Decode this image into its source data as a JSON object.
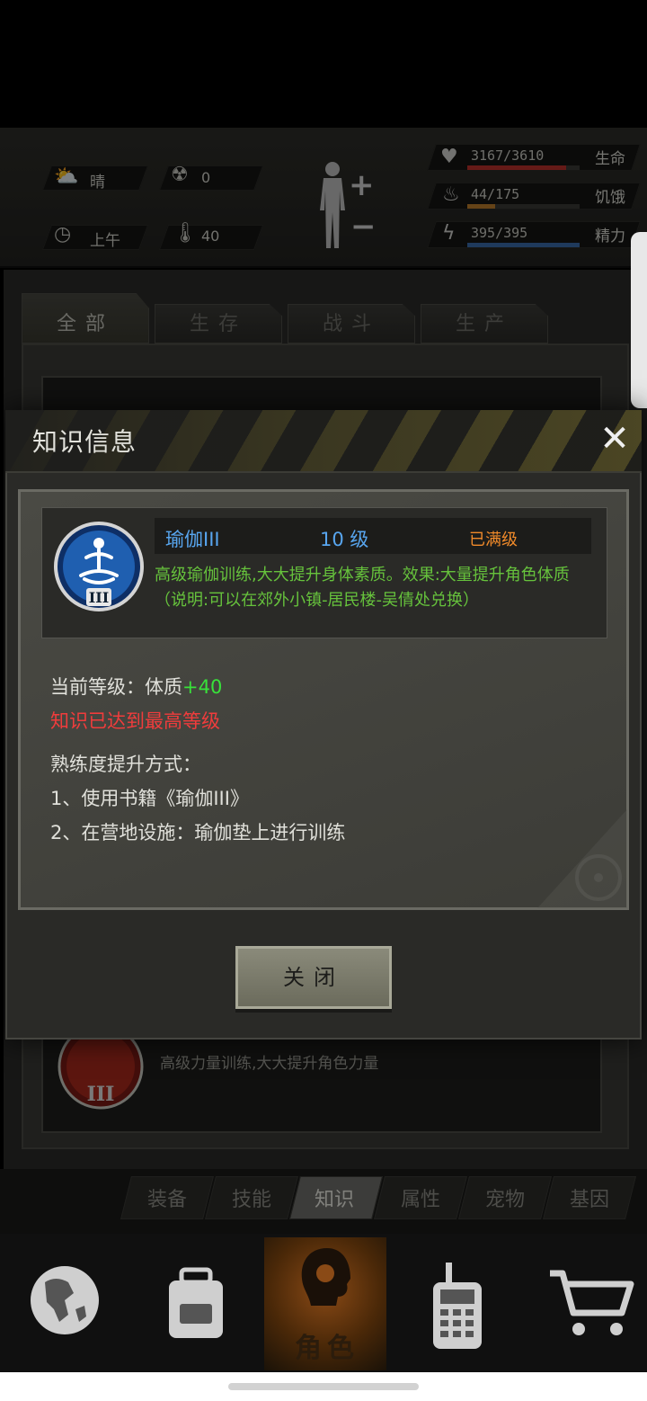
{
  "status": {
    "weather_label": "晴",
    "radiation_value": "0",
    "time_label": "上午",
    "temperature_value": "40",
    "bars": [
      {
        "value": "3167/3610",
        "label": "生命",
        "fill_percent": 87.7,
        "color": "#b8302a"
      },
      {
        "value": "44/175",
        "label": "饥饿",
        "fill_percent": 25.1,
        "color": "#b87a2a"
      },
      {
        "value": "395/395",
        "label": "精力",
        "fill_percent": 100,
        "color": "#3a6aa8"
      }
    ]
  },
  "tabs": [
    "全部",
    "生存",
    "战斗",
    "生产"
  ],
  "background_item": {
    "description": "高级力量训练,大大提升角色力量"
  },
  "sub_tabs": [
    "装备",
    "技能",
    "知识",
    "属性",
    "宠物",
    "基因"
  ],
  "nav": {
    "active_label": "角色"
  },
  "dialog": {
    "title": "知识信息",
    "skill": {
      "name": "瑜伽III",
      "level": "10 级",
      "max_badge": "已满级",
      "description": "高级瑜伽训练,大大提升身体素质。效果:大量提升角色体质（说明:可以在郊外小镇-居民楼-吴倩处兑换）"
    },
    "current_level_prefix": "当前等级：体质",
    "current_level_bonus": "+40",
    "max_reached_text": "知识已达到最高等级",
    "method_title": "熟练度提升方式：",
    "methods": [
      "1、使用书籍《瑜伽III》",
      "2、在营地设施：瑜伽垫上进行训练"
    ],
    "close_button": "关闭"
  },
  "colors": {
    "accent_blue": "#58a6f0",
    "desc_green": "#66c23c",
    "warn_red": "#f03c3c",
    "max_orange": "#f08a2a"
  }
}
